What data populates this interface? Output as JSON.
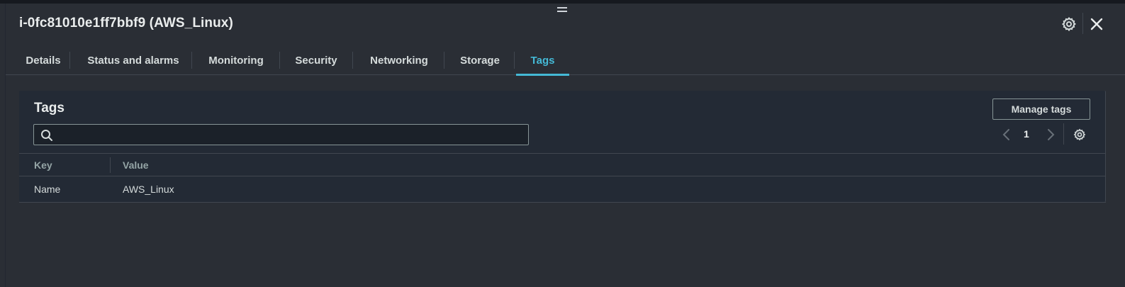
{
  "header": {
    "title": "i-0fc81010e1ff7bbf9 (AWS_Linux)",
    "settings_icon": "gear-icon",
    "close_icon": "close-icon"
  },
  "tabs": [
    {
      "label": "Details"
    },
    {
      "label": "Status and alarms"
    },
    {
      "label": "Monitoring"
    },
    {
      "label": "Security"
    },
    {
      "label": "Networking"
    },
    {
      "label": "Storage"
    },
    {
      "label": "Tags",
      "active": true
    }
  ],
  "tags_panel": {
    "title": "Tags",
    "manage_button": "Manage tags",
    "search": {
      "value": "",
      "placeholder": ""
    },
    "pagination": {
      "current_page": "1"
    },
    "columns": [
      "Key",
      "Value"
    ],
    "rows": [
      {
        "key": "Name",
        "value": "AWS_Linux"
      }
    ]
  },
  "colors": {
    "accent": "#44b9d6",
    "background": "#2a2e35",
    "panel": "#232a35"
  }
}
